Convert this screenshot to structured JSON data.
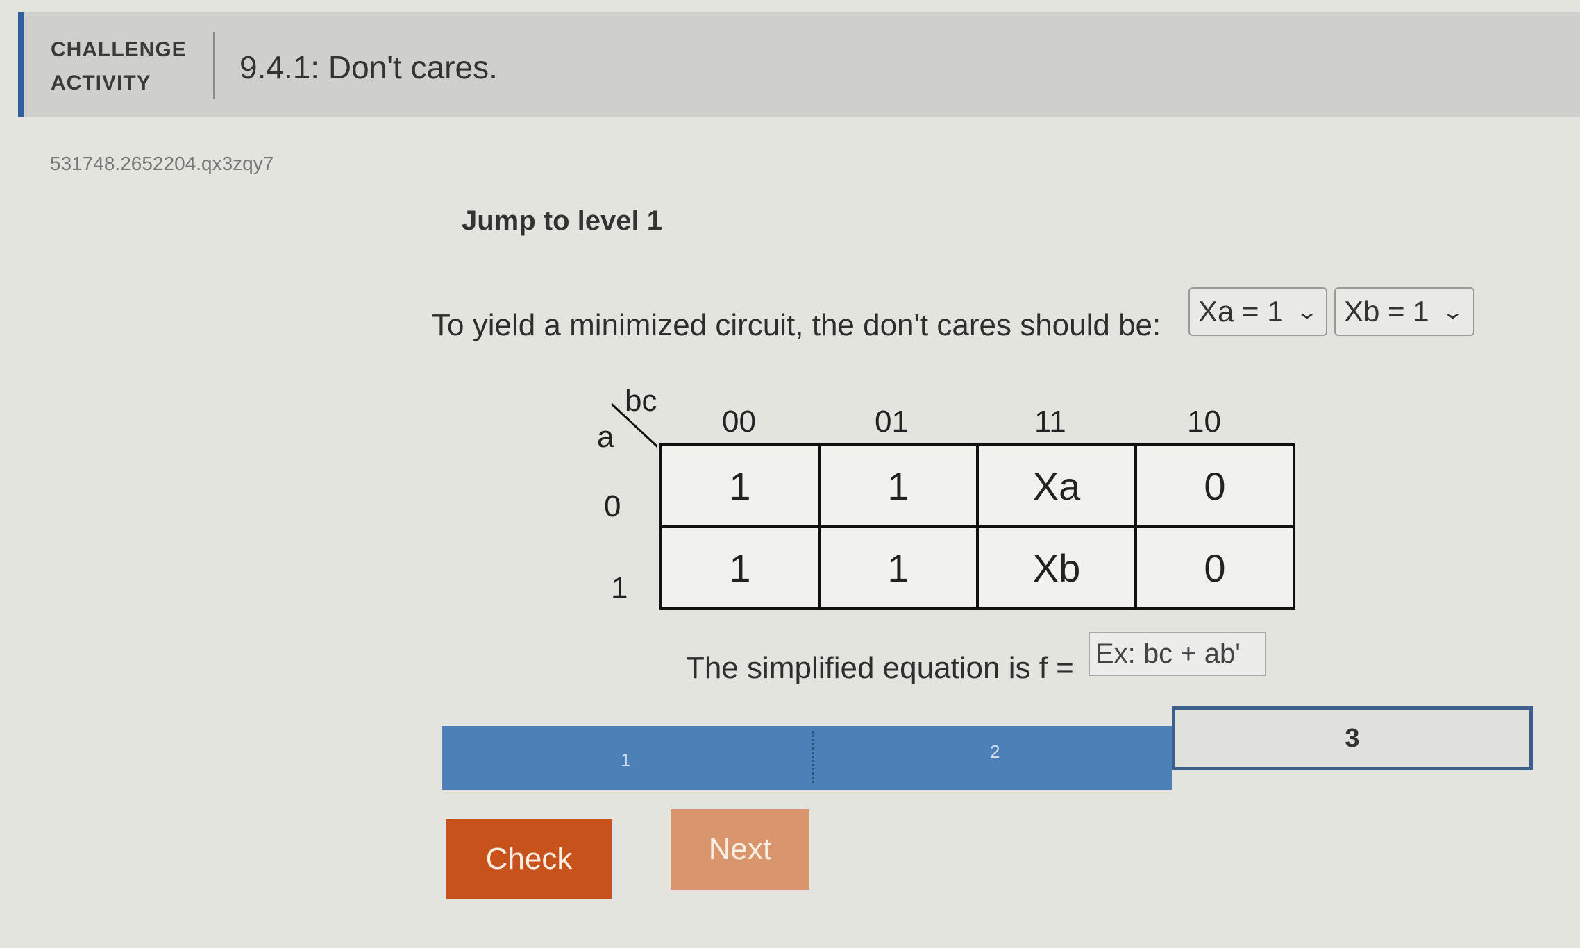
{
  "header": {
    "label_line1": "CHALLENGE",
    "label_line2": "ACTIVITY",
    "title": "9.4.1: Don't cares."
  },
  "activity_id": "531748.2652204.qx3zqy7",
  "jump_link": "Jump to level 1",
  "question": {
    "prompt": "To yield a minimized circuit, the don't cares should be:",
    "dropdown_a": {
      "selected": "Xa = 1"
    },
    "dropdown_b": {
      "selected": "Xb = 1"
    }
  },
  "kmap": {
    "col_var": "bc",
    "row_var": "a",
    "col_headers": [
      "00",
      "01",
      "11",
      "10"
    ],
    "row_headers": [
      "0",
      "1"
    ],
    "rows": [
      [
        "1",
        "1",
        "Xa",
        "0"
      ],
      [
        "1",
        "1",
        "Xb",
        "0"
      ]
    ]
  },
  "equation": {
    "label": "The simplified equation is f =",
    "placeholder": "Ex: bc + ab'"
  },
  "progress": {
    "levels": [
      "1",
      "2",
      "3"
    ],
    "completed": 2,
    "current": "3"
  },
  "buttons": {
    "check": "Check",
    "next": "Next"
  },
  "colors": {
    "accent": "#2f5f9e",
    "progress_fill": "#4e80b8",
    "check": "#c8521b",
    "next": "#d9956b"
  }
}
